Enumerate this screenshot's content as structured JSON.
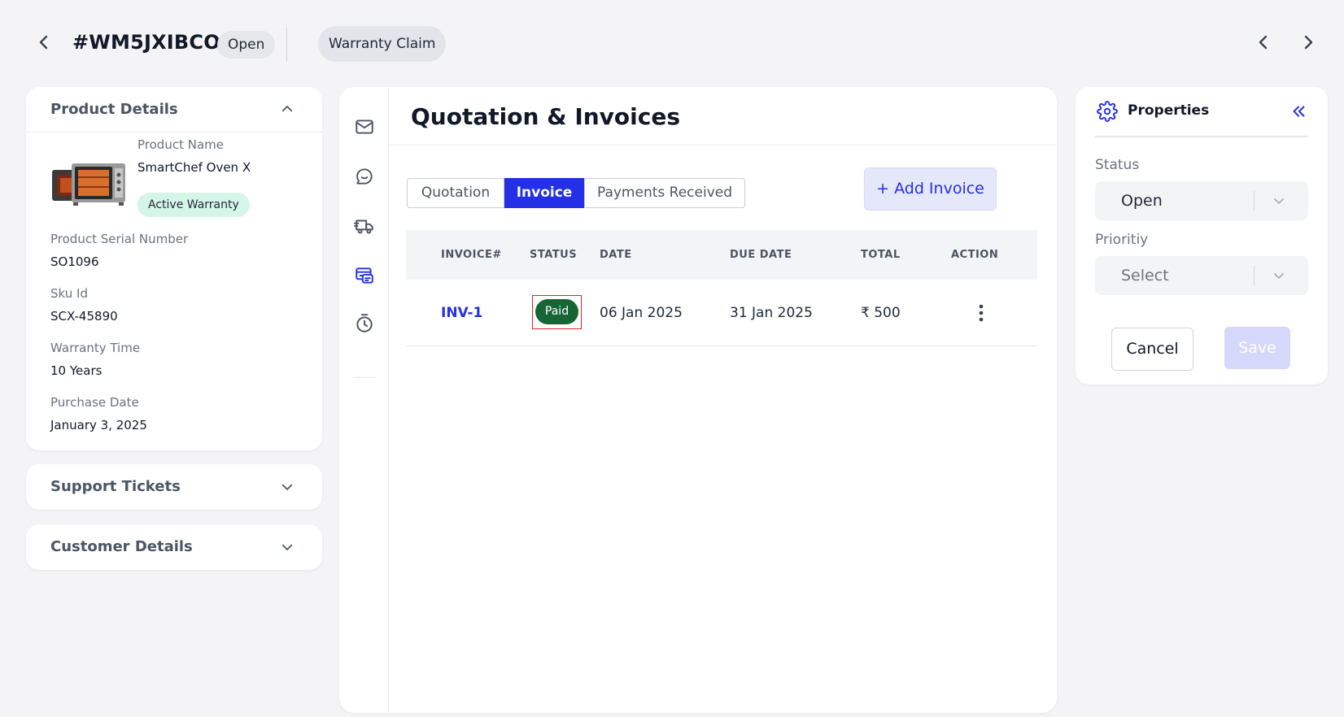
{
  "header": {
    "ticket_id": "#WM5JXIBCO",
    "status_badge": "Open",
    "type_badge": "Warranty Claim"
  },
  "product_details": {
    "title": "Product Details",
    "product_name_label": "Product Name",
    "product_name": "SmartChef Oven X",
    "warranty_badge": "Active Warranty",
    "serial_label": "Product Serial Number",
    "serial": "SO1096",
    "sku_label": "Sku Id",
    "sku": "SCX-45890",
    "warranty_time_label": "Warranty Time",
    "warranty_time": "10 Years",
    "purchase_date_label": "Purchase Date",
    "purchase_date": "January 3, 2025"
  },
  "support_tickets": {
    "title": "Support Tickets"
  },
  "customer_details": {
    "title": "Customer Details"
  },
  "main": {
    "title": "Quotation & Invoices",
    "tabs": [
      "Quotation",
      "Invoice",
      "Payments Received"
    ],
    "active_tab": "Invoice",
    "add_button": "+ Add Invoice",
    "table": {
      "headers": [
        "INVOICE#",
        "STATUS",
        "DATE",
        "DUE DATE",
        "TOTAL",
        "ACTION"
      ],
      "rows": [
        {
          "invoice": "INV-1",
          "status": "Paid",
          "date": "06 Jan 2025",
          "due_date": "31 Jan 2025",
          "total": "₹ 500"
        }
      ]
    }
  },
  "properties": {
    "title": "Properties",
    "status_label": "Status",
    "status_value": "Open",
    "priority_label": "Prioritiy",
    "priority_placeholder": "Select",
    "cancel": "Cancel",
    "save": "Save"
  },
  "colors": {
    "accent": "#2430e6",
    "paid": "#166534",
    "warranty_badge_bg": "#d5f5e8",
    "highlight_border": "#dc2626"
  },
  "icons": {
    "rail": [
      "mail-icon",
      "chat-icon",
      "truck-icon",
      "billing-icon",
      "timer-icon"
    ]
  }
}
